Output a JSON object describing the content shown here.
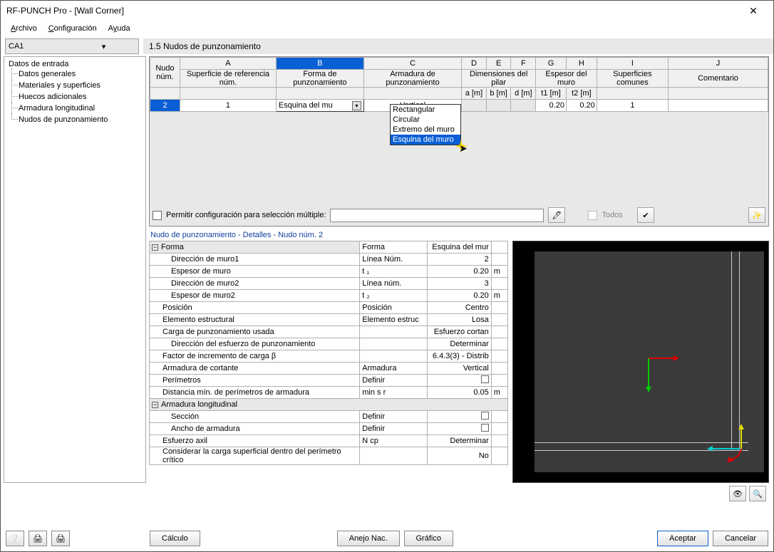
{
  "window": {
    "title": "RF-PUNCH Pro - [Wall Corner]",
    "close": "✕"
  },
  "menu": {
    "archivo": "Archivo",
    "config": "Configuración",
    "ayuda": "Ayuda"
  },
  "combo": {
    "value": "CA1"
  },
  "section": {
    "title": "1.5 Nudos de punzonamiento"
  },
  "tree": {
    "root": "Datos de entrada",
    "items": [
      "Datos generales",
      "Materiales y superficies",
      "Huecos adicionales",
      "Armadura longitudinal",
      "Nudos de punzonamiento"
    ]
  },
  "grid": {
    "letters": [
      "A",
      "B",
      "C",
      "D",
      "E",
      "F",
      "G",
      "H",
      "I",
      "J"
    ],
    "h_nudo": "Nudo núm.",
    "h_sup": "Superficie de referencia núm.",
    "h_forma": "Forma de punzonamiento",
    "h_arm": "Armadura de punzonamiento",
    "h_dim": "Dimensiones del pilar",
    "h_a": "a [m]",
    "h_b": "b [m]",
    "h_d": "d [m]",
    "h_esp": "Espesor del muro",
    "h_t1": "t1 [m]",
    "h_t2": "t2 [m]",
    "h_supcom": "Superficies comunes",
    "h_com": "Comentario",
    "row": {
      "num": "2",
      "sup": "1",
      "forma": "Esquina del mu",
      "arm": "Vertical",
      "t1": "0.20",
      "t2": "0.20",
      "sc": "1"
    }
  },
  "dropdown": {
    "opts": [
      "Rectangular",
      "Circular",
      "Extremo del muro",
      "Esquina del muro"
    ]
  },
  "cfgrow": {
    "label": "Permitir configuración para selección múltiple:",
    "todos": "Todos"
  },
  "detail_title": "Nudo de punzonamiento - Detalles - Nudo núm.  2",
  "det": {
    "forma": "Forma",
    "forma_c": "Forma",
    "forma_v": "Esquina del mur",
    "dir1": "Dirección de muro1",
    "dir1_c": "Línea Núm.",
    "dir1_v": "2",
    "esp1": "Espesor de muro",
    "esp1_c": "t ₁",
    "esp1_v": "0.20",
    "u_m": "m",
    "dir2": "Dirección de muro2",
    "dir2_c": "Línea núm.",
    "dir2_v": "3",
    "esp2": "Espesor de muro2",
    "esp2_c": "t ₂",
    "esp2_v": "0.20",
    "pos": "Posición",
    "pos_c": "Posición",
    "pos_v": "Centro",
    "elem": "Elemento estructural",
    "elem_c": "Elemento estruc",
    "elem_v": "Losa",
    "carga": "Carga de punzonamiento usada",
    "carga_v": "Esfuerzo cortan",
    "diresf": "Dirección del esfuerzo de punzonamiento",
    "diresf_v": "Determinar",
    "factor": "Factor de incremento de carga β",
    "factor_v": "6.4.3(3) - Distrib",
    "armcort": "Armadura de cortante",
    "armcort_c": "Armadura",
    "armcort_v": "Vertical",
    "perim": "Perímetros",
    "perim_c": "Definir",
    "dist": "Distancia mín. de perímetros de armadura",
    "dist_c": "min s r",
    "dist_v": "0.05",
    "armlong": "Armadura longitudinal",
    "secc": "Sección",
    "secc_c": "Definir",
    "ancho": "Ancho de armadura",
    "ancho_c": "Definir",
    "esfax": "Esfuerzo axil",
    "esfax_c": "N cp",
    "esfax_v": "Determinar",
    "cons": "Considerar la carga superficial dentro del perímetro crítico",
    "cons_v": "No"
  },
  "buttons": {
    "calculo": "Cálculo",
    "anejo": "Anejo Nac.",
    "grafico": "Gráfico",
    "aceptar": "Aceptar",
    "cancelar": "Cancelar"
  }
}
